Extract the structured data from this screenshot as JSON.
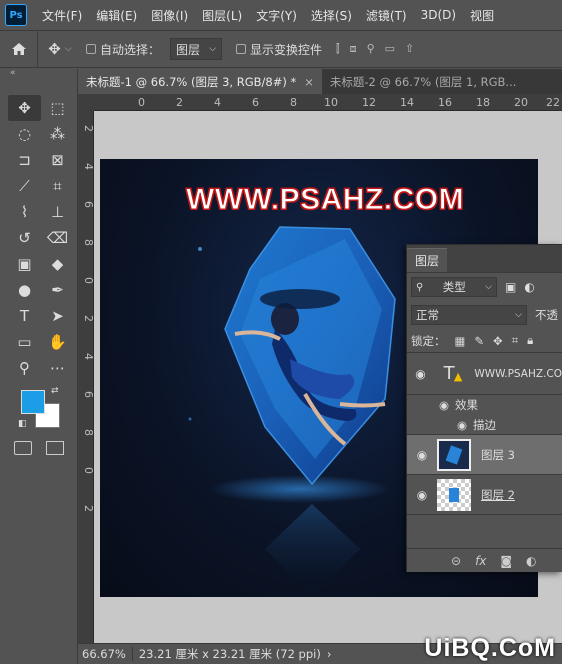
{
  "menu": [
    "文件(F)",
    "编辑(E)",
    "图像(I)",
    "图层(L)",
    "文字(Y)",
    "选择(S)",
    "滤镜(T)",
    "3D(D)",
    "视图"
  ],
  "options": {
    "auto_select_label": "自动选择：",
    "auto_select_value": "图层",
    "show_transform_label": "显示变换控件"
  },
  "tabs": [
    {
      "label": "未标题-1 @ 66.7% (图层 3, RGB/8#) *",
      "active": true
    },
    {
      "label": "未标题-2 @ 66.7% (图层 1, RGB...",
      "active": false
    }
  ],
  "ruler_top": [
    "0",
    "2",
    "4",
    "6",
    "8",
    "10",
    "12",
    "14",
    "16",
    "18",
    "20",
    "22"
  ],
  "ruler_left": [
    "2",
    "4",
    "6",
    "8",
    "0",
    "2",
    "4",
    "6",
    "8",
    "0",
    "2"
  ],
  "canvas": {
    "title_text": "WWW.PSAHZ.COM"
  },
  "layers_panel": {
    "tab": "图层",
    "kind_filter": "类型",
    "blend_mode": "正常",
    "opacity_label": "不透",
    "lock_label": "锁定：",
    "layers": [
      {
        "name": "WWW.PSAHZ.CO",
        "type": "text",
        "visible": true,
        "selected": false
      },
      {
        "name": "效果",
        "type": "effects",
        "visible": true
      },
      {
        "name": "描边",
        "type": "effect",
        "visible": true
      },
      {
        "name": "图层 3",
        "type": "pixel",
        "visible": true,
        "selected": true
      },
      {
        "name": "图层 2",
        "type": "pixel",
        "visible": true,
        "selected": false
      }
    ]
  },
  "status": {
    "zoom": "66.67%",
    "doc_info": "23.21 厘米 x 23.21 厘米 (72 ppi)"
  },
  "watermark": "UiBQ.CoM",
  "colors": {
    "foreground": "#1b9ee5",
    "background": "#ffffff"
  }
}
